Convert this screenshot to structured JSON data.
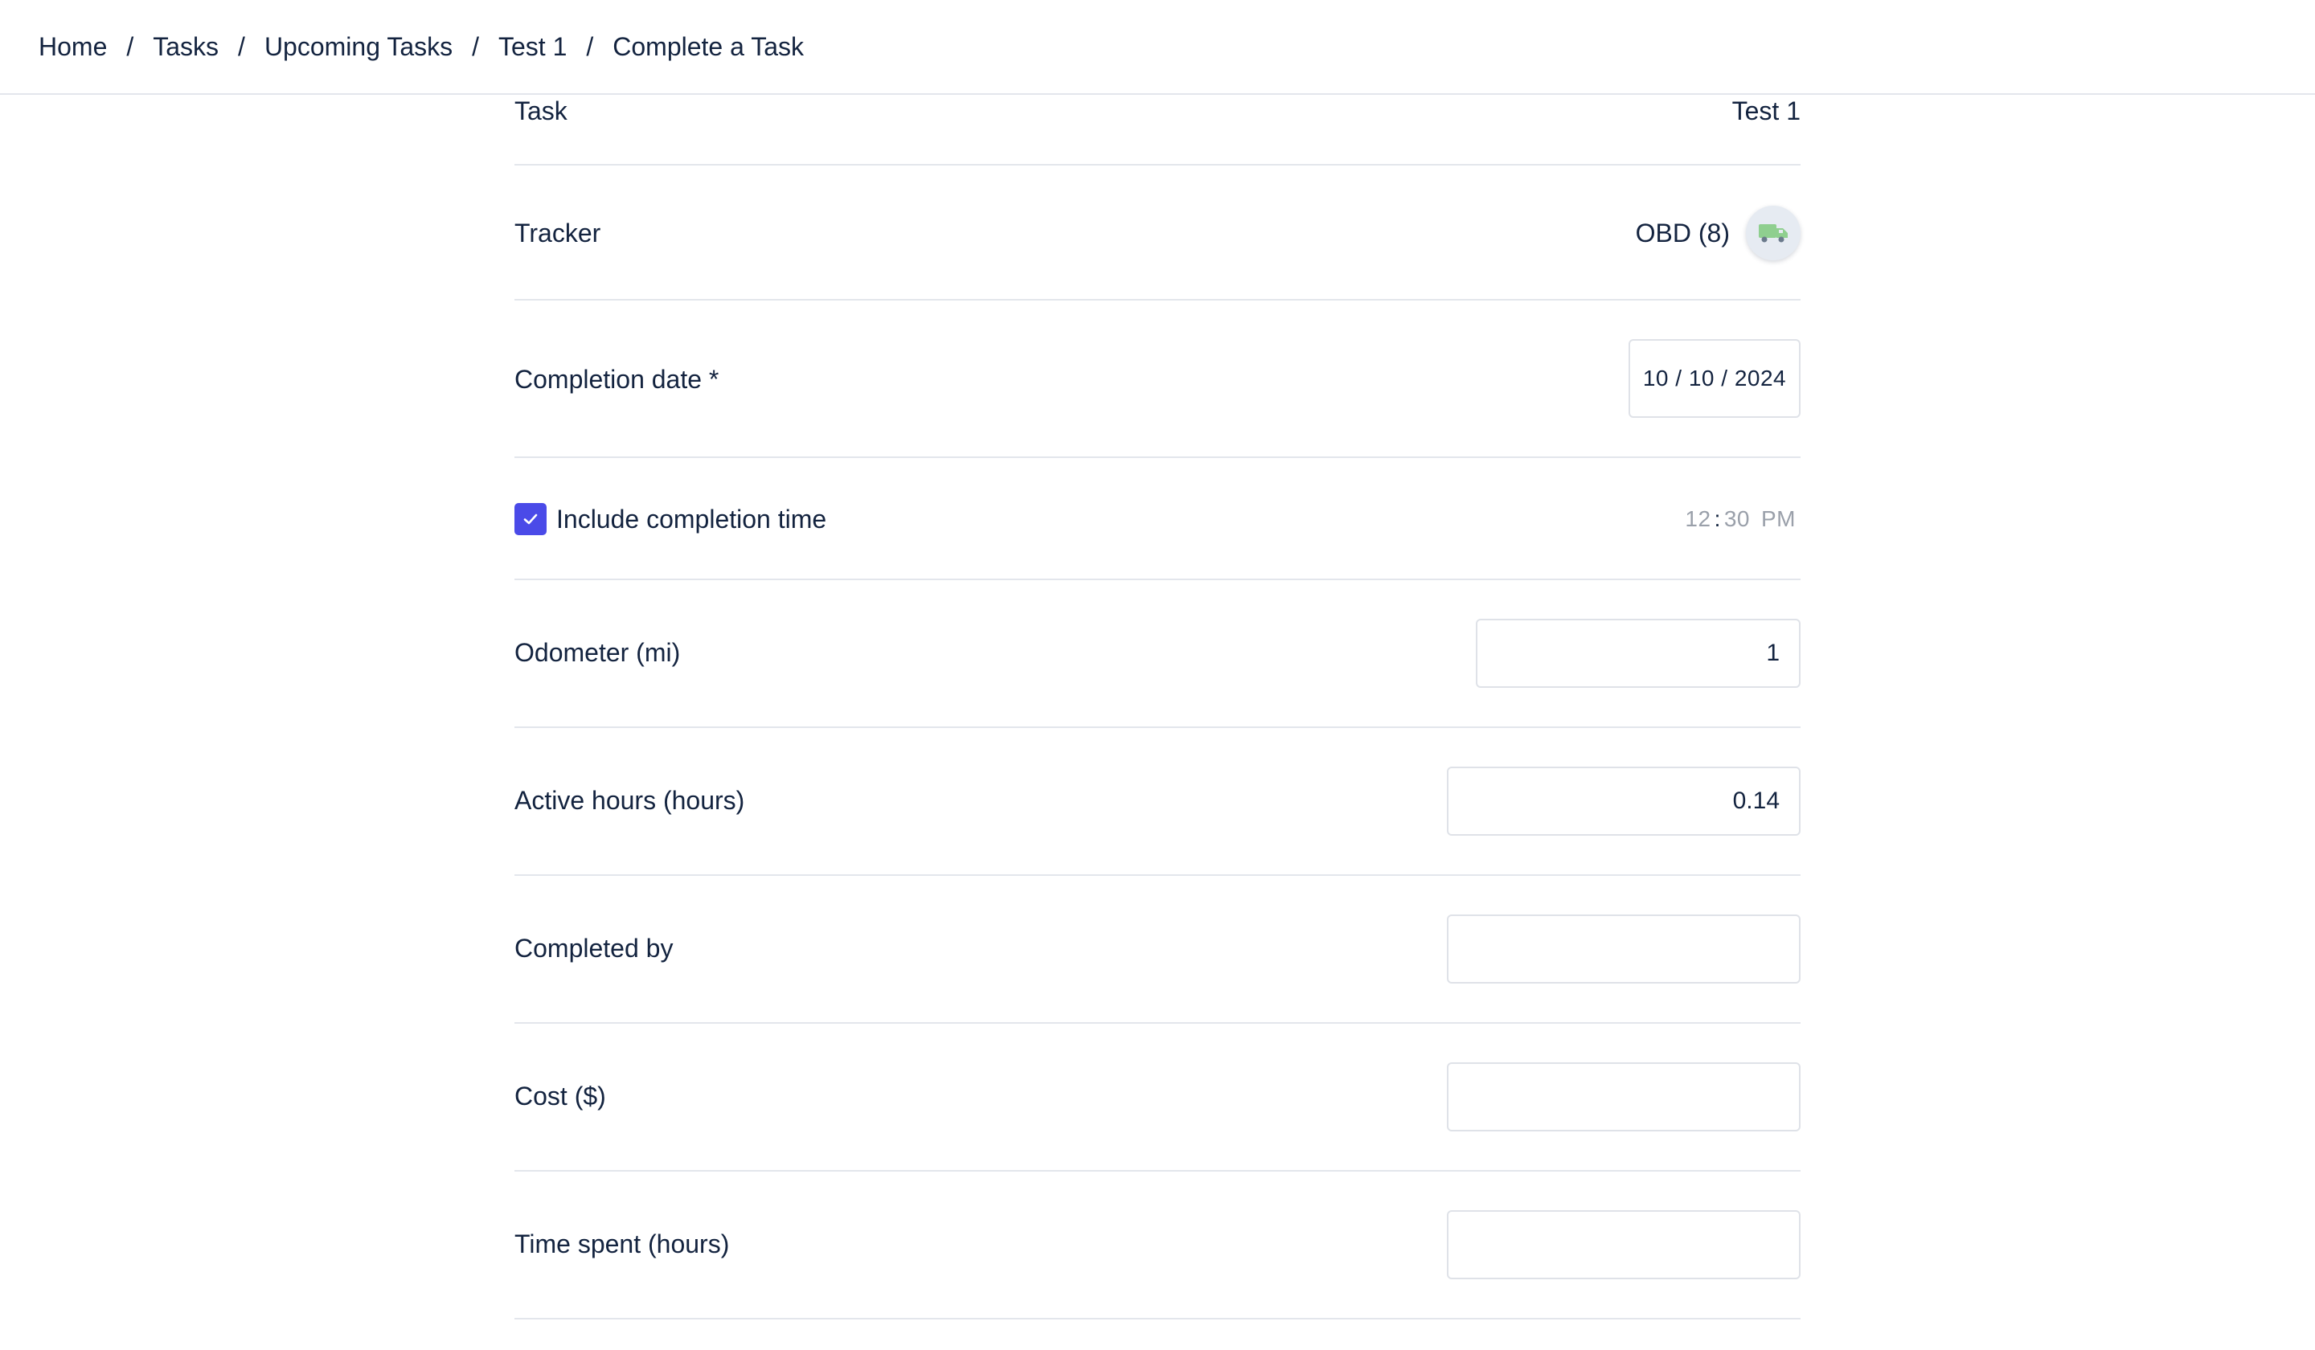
{
  "breadcrumb": {
    "items": [
      "Home",
      "Tasks",
      "Upcoming Tasks",
      "Test 1",
      "Complete a Task"
    ],
    "separator": "/"
  },
  "form": {
    "task": {
      "label": "Task",
      "value": "Test 1"
    },
    "tracker": {
      "label": "Tracker",
      "value": "OBD (8)",
      "icon": "truck-icon"
    },
    "completion_date": {
      "label": "Completion date *",
      "value": "10 / 10 / 2024"
    },
    "include_time": {
      "label": "Include completion time",
      "checked": true,
      "hour": "12",
      "colon": ":",
      "minute": "30",
      "ampm": "PM"
    },
    "odometer": {
      "label": "Odometer (mi)",
      "value": "1"
    },
    "active_hours": {
      "label": "Active hours (hours)",
      "value": "0.14"
    },
    "completed_by": {
      "label": "Completed by",
      "value": ""
    },
    "cost": {
      "label": "Cost ($)",
      "value": ""
    },
    "time_spent": {
      "label": "Time spent (hours)",
      "value": ""
    }
  },
  "colors": {
    "accent": "#4a4ae8",
    "text": "#13233f",
    "muted": "#9aa0aa",
    "divider": "#e3e6ec",
    "truck": "#8fcf8f"
  }
}
